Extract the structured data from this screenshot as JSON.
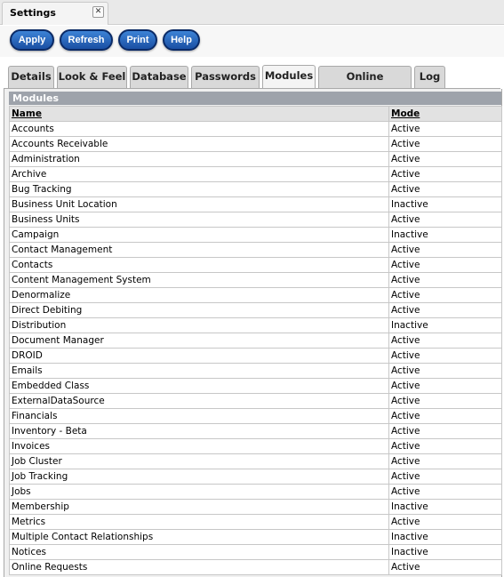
{
  "window": {
    "tab_title": "Settings",
    "close_glyph": "✕"
  },
  "toolbar": {
    "apply_label": "Apply",
    "refresh_label": "Refresh",
    "print_label": "Print",
    "help_label": "Help"
  },
  "tabs": [
    {
      "label": "Details",
      "active": false
    },
    {
      "label": "Look & Feel",
      "active": false
    },
    {
      "label": "Database",
      "active": false
    },
    {
      "label": "Passwords",
      "active": false
    },
    {
      "label": "Modules",
      "active": true
    },
    {
      "label": "Online Requests",
      "active": false
    },
    {
      "label": "Log",
      "active": false
    }
  ],
  "modules": {
    "header": "Modules",
    "columns": {
      "name": "Name",
      "mode": "Mode"
    },
    "rows": [
      {
        "name": "Accounts",
        "mode": "Active"
      },
      {
        "name": "Accounts Receivable",
        "mode": "Active"
      },
      {
        "name": "Administration",
        "mode": "Active"
      },
      {
        "name": "Archive",
        "mode": "Active"
      },
      {
        "name": "Bug Tracking",
        "mode": "Active"
      },
      {
        "name": "Business Unit Location",
        "mode": "Inactive"
      },
      {
        "name": "Business Units",
        "mode": "Active"
      },
      {
        "name": "Campaign",
        "mode": "Inactive"
      },
      {
        "name": "Contact Management",
        "mode": "Active"
      },
      {
        "name": "Contacts",
        "mode": "Active"
      },
      {
        "name": "Content Management System",
        "mode": "Active"
      },
      {
        "name": "Denormalize",
        "mode": "Active"
      },
      {
        "name": "Direct Debiting",
        "mode": "Active"
      },
      {
        "name": "Distribution",
        "mode": "Inactive"
      },
      {
        "name": "Document Manager",
        "mode": "Active"
      },
      {
        "name": "DROID",
        "mode": "Active"
      },
      {
        "name": "Emails",
        "mode": "Active"
      },
      {
        "name": "Embedded Class",
        "mode": "Active"
      },
      {
        "name": "ExternalDataSource",
        "mode": "Active"
      },
      {
        "name": "Financials",
        "mode": "Active"
      },
      {
        "name": "Inventory - Beta",
        "mode": "Active"
      },
      {
        "name": "Invoices",
        "mode": "Active"
      },
      {
        "name": "Job Cluster",
        "mode": "Active"
      },
      {
        "name": "Job Tracking",
        "mode": "Active"
      },
      {
        "name": "Jobs",
        "mode": "Active"
      },
      {
        "name": "Membership",
        "mode": "Inactive"
      },
      {
        "name": "Metrics",
        "mode": "Active"
      },
      {
        "name": "Multiple Contact Relationships",
        "mode": "Inactive"
      },
      {
        "name": "Notices",
        "mode": "Inactive"
      },
      {
        "name": "Online Requests",
        "mode": "Active"
      }
    ]
  }
}
